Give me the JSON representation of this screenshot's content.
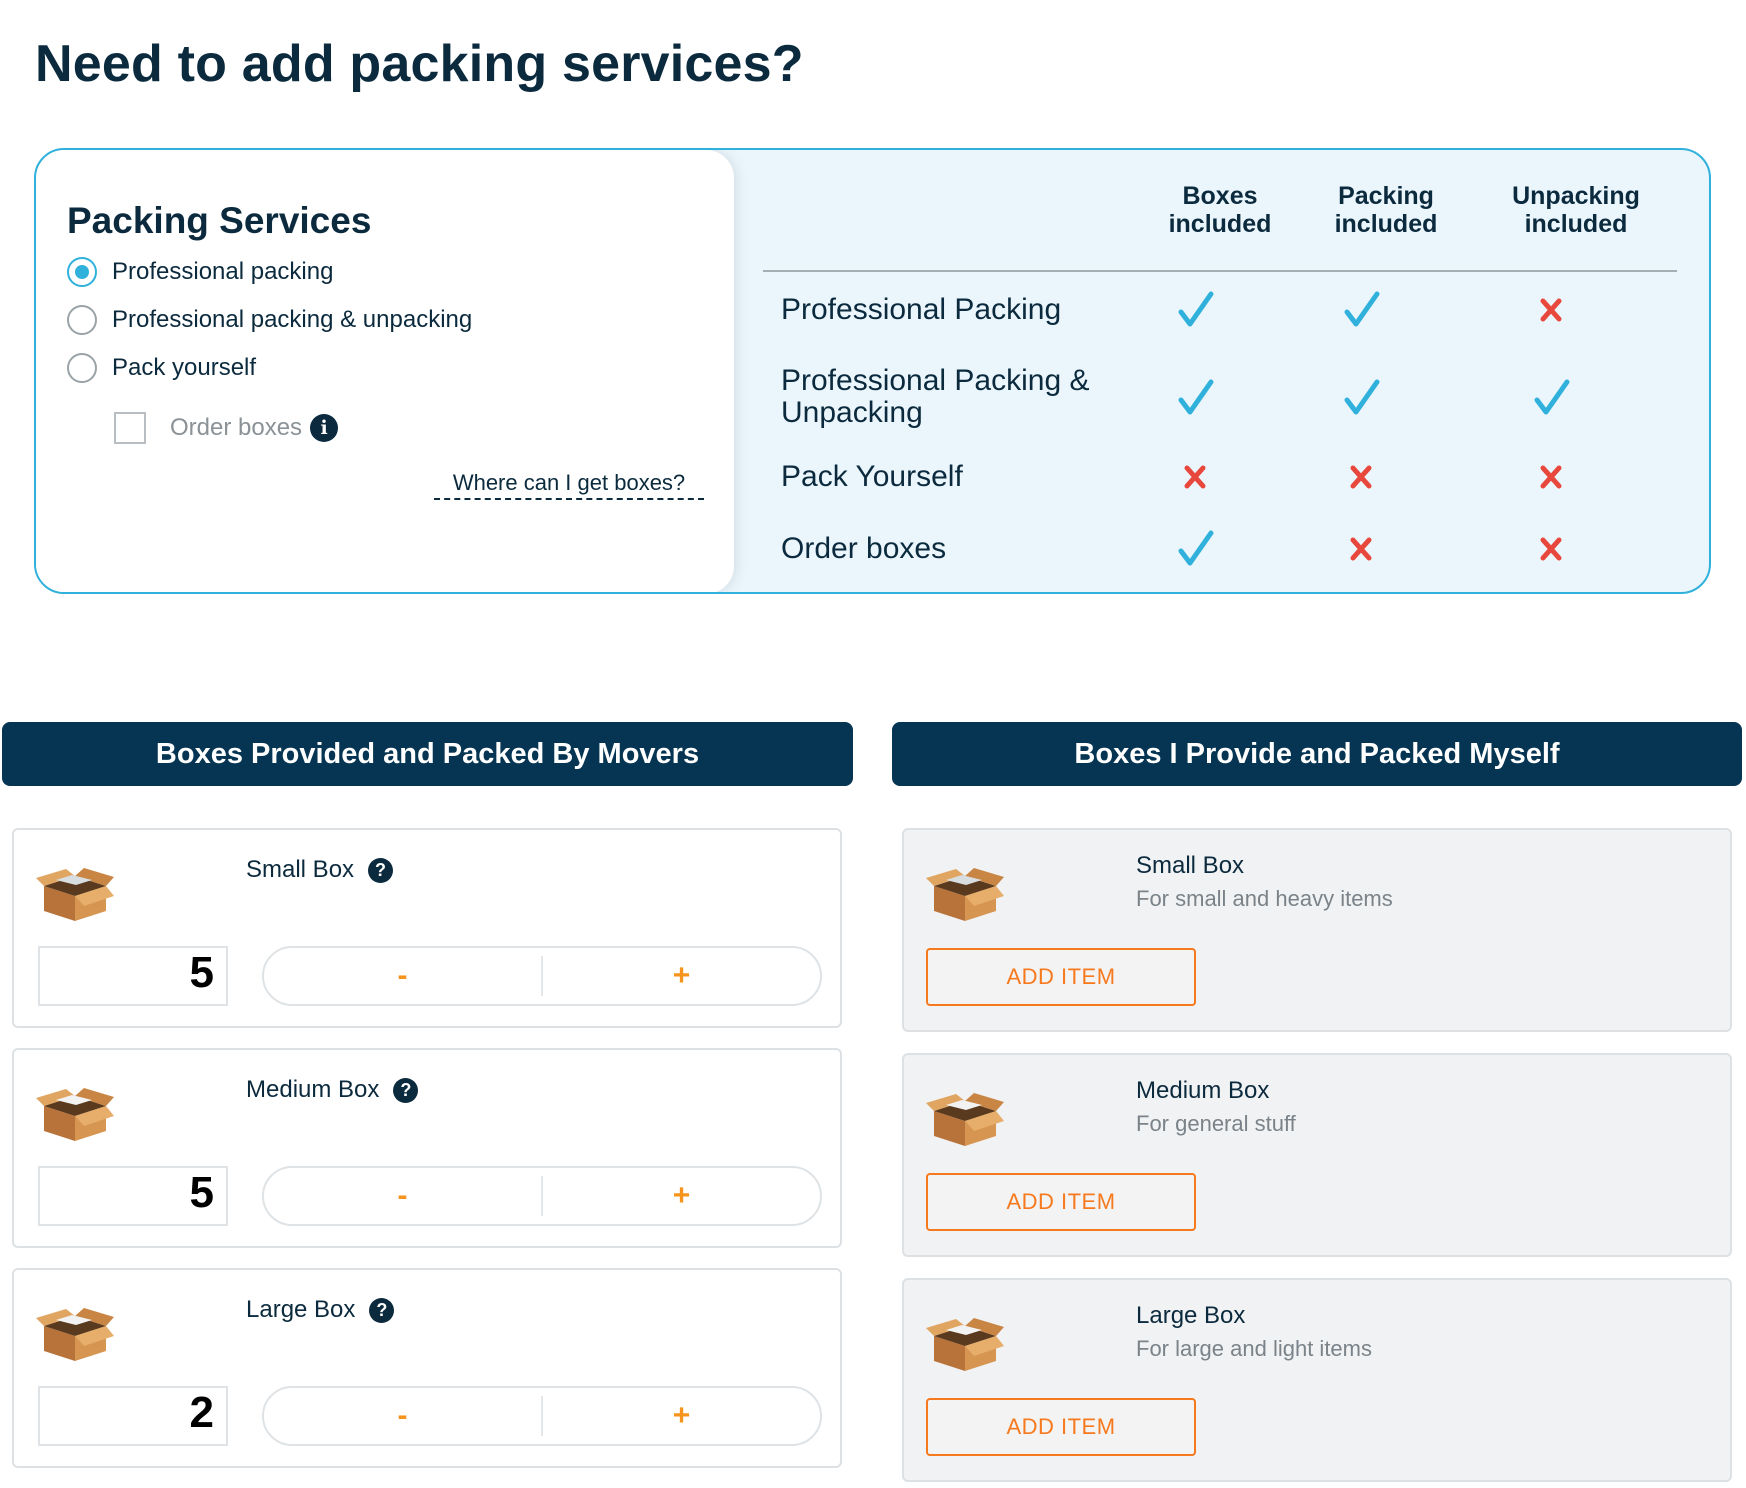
{
  "page_title": "Need to add packing services?",
  "packing_services": {
    "title": "Packing Services",
    "options": [
      {
        "label": "Professional packing",
        "checked": true
      },
      {
        "label": "Professional packing & unpacking",
        "checked": false
      },
      {
        "label": "Pack yourself",
        "checked": false
      }
    ],
    "order_boxes": {
      "label": "Order boxes",
      "checked": false,
      "icon": "info-icon"
    },
    "where_link": "Where can I get boxes?"
  },
  "comparison": {
    "columns": [
      "Boxes included",
      "Packing included",
      "Unpacking included"
    ],
    "rows": [
      {
        "label": "Professional Packing",
        "values": [
          true,
          true,
          false
        ]
      },
      {
        "label": "Professional Packing & Unpacking",
        "values": [
          true,
          true,
          true
        ]
      },
      {
        "label": "Pack Yourself",
        "values": [
          false,
          false,
          false
        ]
      },
      {
        "label": "Order boxes",
        "values": [
          true,
          false,
          false
        ]
      }
    ],
    "colors": {
      "check": "#2fb1dc",
      "cross": "#e8473c"
    }
  },
  "movers_section": {
    "title": "Boxes Provided and Packed By Movers",
    "boxes": [
      {
        "name": "Small Box",
        "quantity": "5",
        "minus": "-",
        "plus": "+"
      },
      {
        "name": "Medium Box",
        "quantity": "5",
        "minus": "-",
        "plus": "+"
      },
      {
        "name": "Large Box",
        "quantity": "2",
        "minus": "-",
        "plus": "+"
      }
    ]
  },
  "self_section": {
    "title": "Boxes I Provide and Packed Myself",
    "boxes": [
      {
        "name": "Small Box",
        "description": "For small and heavy items",
        "button": "ADD ITEM"
      },
      {
        "name": "Medium Box",
        "description": "For general stuff",
        "button": "ADD ITEM"
      },
      {
        "name": "Large Box",
        "description": "For large and light items",
        "button": "ADD ITEM"
      }
    ]
  },
  "theme": {
    "navy": "#053552",
    "accent": "#2fb1dc",
    "orange": "#f7791d"
  }
}
